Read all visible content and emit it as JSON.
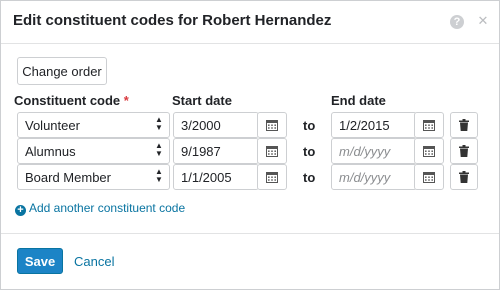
{
  "dialog": {
    "title": "Edit constituent codes for Robert Hernandez",
    "help_icon": "question-circle-icon",
    "close_icon": "close-icon"
  },
  "toolbar": {
    "change_order_label": "Change order"
  },
  "columns": {
    "code": "Constituent code",
    "required_marker": "*",
    "start": "Start date",
    "end": "End date"
  },
  "rows": [
    {
      "code": "Volunteer",
      "start": "3/2000",
      "to": "to",
      "end": "1/2/2015",
      "end_placeholder": "m/d/yyyy"
    },
    {
      "code": "Alumnus",
      "start": "9/1987",
      "to": "to",
      "end": "",
      "end_placeholder": "m/d/yyyy"
    },
    {
      "code": "Board Member",
      "start": "1/1/2005",
      "to": "to",
      "end": "",
      "end_placeholder": "m/d/yyyy"
    }
  ],
  "add_link": "Add another constituent code",
  "footer": {
    "save_label": "Save",
    "cancel_label": "Cancel"
  },
  "colors": {
    "primary": "#1c84c6",
    "link": "#0974a1",
    "required": "#d93a3f",
    "border": "#cdcfd2"
  }
}
